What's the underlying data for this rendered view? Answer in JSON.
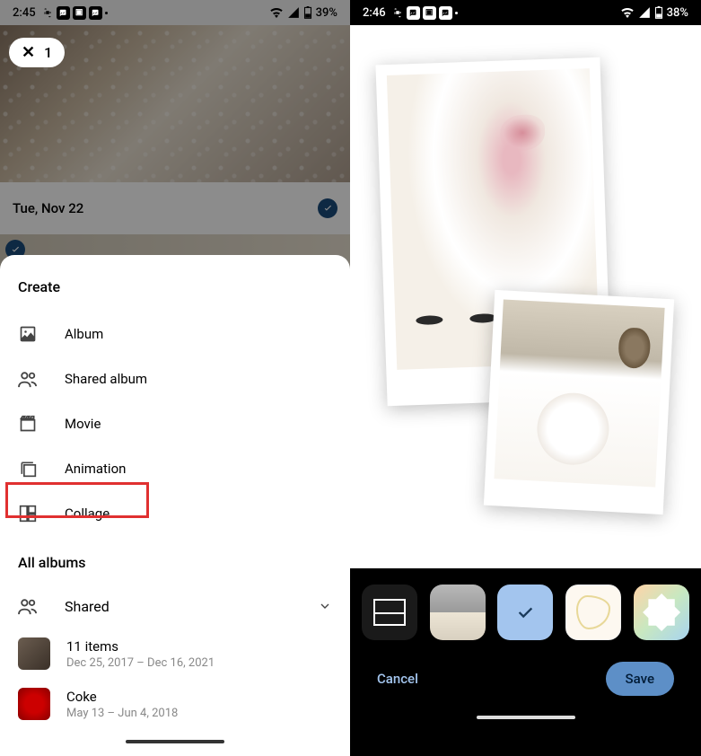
{
  "left": {
    "status": {
      "time": "2:45",
      "battery": "39%"
    },
    "selection_count": "1",
    "date_header": "Tue, Nov 22",
    "sheet": {
      "title": "Create",
      "items": [
        {
          "label": "Album"
        },
        {
          "label": "Shared album"
        },
        {
          "label": "Movie"
        },
        {
          "label": "Animation"
        },
        {
          "label": "Collage"
        }
      ],
      "all_albums_title": "All albums",
      "shared_label": "Shared",
      "albums": [
        {
          "name": "11 items",
          "dates": "Dec 25, 2017 – Dec 16, 2021"
        },
        {
          "name": "Coke",
          "dates": "May 13 – Jun 4, 2018"
        }
      ]
    }
  },
  "right": {
    "status": {
      "time": "2:46",
      "battery": "38%"
    },
    "actions": {
      "cancel": "Cancel",
      "save": "Save"
    }
  }
}
